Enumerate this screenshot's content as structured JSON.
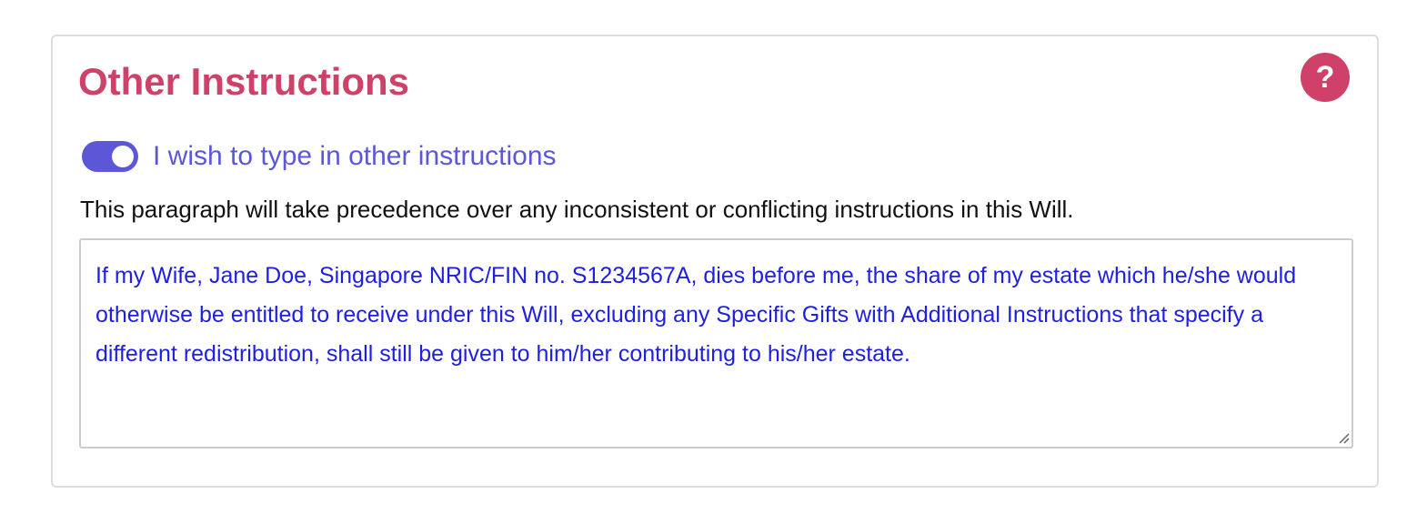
{
  "section": {
    "title": "Other Instructions",
    "help_icon": "question-mark-icon",
    "help_symbol": "?",
    "toggle": {
      "label": "I wish to type in other instructions",
      "checked": true
    },
    "description": "This paragraph will take precedence over any inconsistent or conflicting instructions in this Will.",
    "instructions_value": "If my Wife, Jane Doe, Singapore NRIC/FIN no. S1234567A, dies before me, the share of my estate which he/she would otherwise be entitled to receive under this Will, excluding any Specific Gifts with Additional Instructions that specify a different redistribution, shall still be given to him/her contributing to his/her estate."
  },
  "colors": {
    "accent": "#cf4168",
    "toggle": "#5b57d6",
    "input_text": "#1f1fe0"
  }
}
